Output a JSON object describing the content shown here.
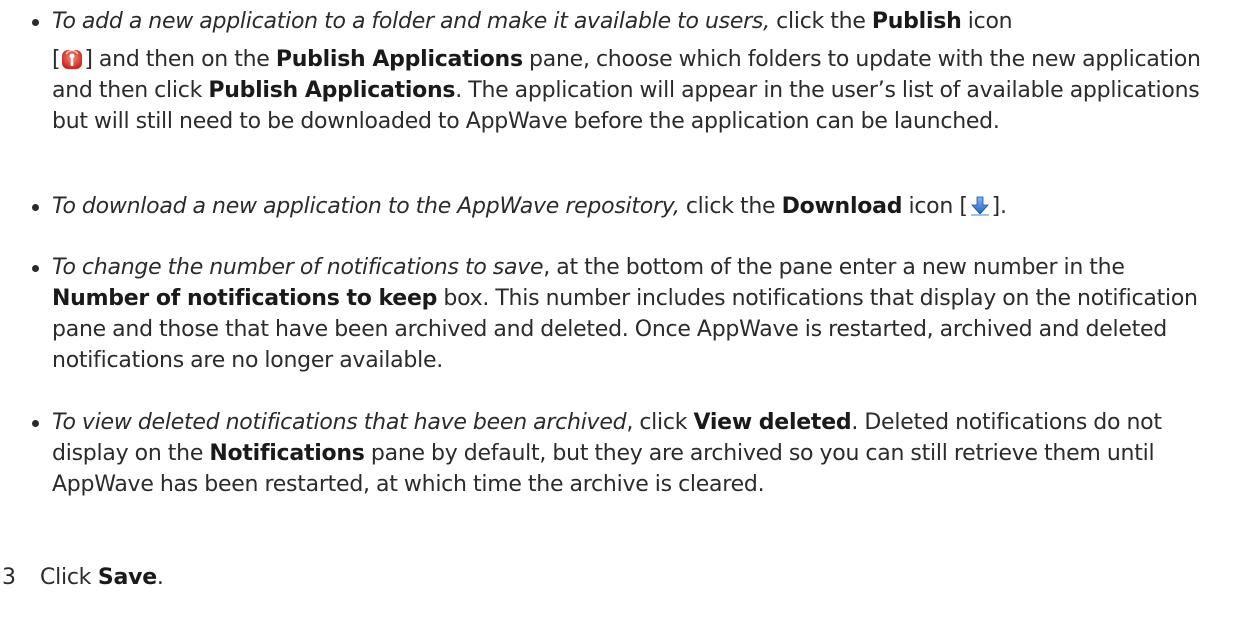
{
  "bullets": [
    {
      "italic": "To add a new application to a folder and make it available to users,",
      "t1": " click the ",
      "b1": "Publish",
      "t2": " icon",
      "open_bracket": "[",
      "icon": "publish-icon",
      "t3": "] and then on the ",
      "b2": "Publish Applications",
      "t4": " pane, choose which folders to update with the new application and then click ",
      "b3": "Publish Applications",
      "t5": ". The application will appear in the user’s list of available applications but will still need to be downloaded to AppWave before the application can be launched."
    },
    {
      "italic": "To download a new application to the AppWave repository,",
      "t1": " click the ",
      "b1": "Download",
      "t2": " icon [",
      "icon": "download-icon",
      "t3": "]."
    },
    {
      "italic": "To change the number of notifications to save",
      "t1": ", at the bottom of the pane enter a new number in the ",
      "b1": "Number of notifications to keep",
      "t2": " box. This number includes notifications that display on the notification pane and those that have been archived and deleted. Once AppWave is restarted, archived and deleted notifications are no longer available."
    },
    {
      "italic": "To view deleted notifications that have been archived",
      "t1": ", click ",
      "b1": "View deleted",
      "t2": ". Deleted notifications do not display on the ",
      "b2": "Notifications",
      "t3": " pane by default, but they are archived so you can still retrieve them until AppWave has been restarted, at which time the archive is cleared."
    }
  ],
  "step": {
    "number": "3",
    "t1": "Click ",
    "b1": "Save",
    "t2": "."
  },
  "colors": {
    "text": "#2b2b2b",
    "publish_icon_red": "#d9342b",
    "download_icon_blue": "#2f7fd6"
  }
}
